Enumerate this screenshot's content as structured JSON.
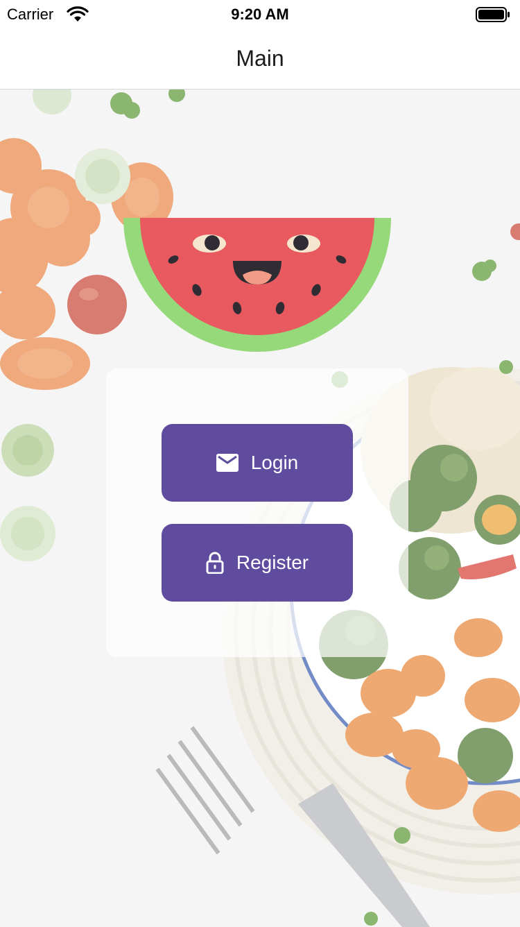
{
  "status_bar": {
    "carrier": "Carrier",
    "time": "9:20 AM",
    "wifi_icon": "wifi-icon",
    "battery_icon": "battery-icon"
  },
  "nav": {
    "title": "Main"
  },
  "logo": {
    "icon": "watermelon-logo-icon"
  },
  "buttons": {
    "login": {
      "label": "Login",
      "icon": "mail-icon"
    },
    "register": {
      "label": "Register",
      "icon": "lock-icon"
    }
  },
  "colors": {
    "button_bg": "#5f4c9e",
    "watermelon_flesh": "#e85a5f",
    "watermelon_rind": "#96d97a"
  }
}
